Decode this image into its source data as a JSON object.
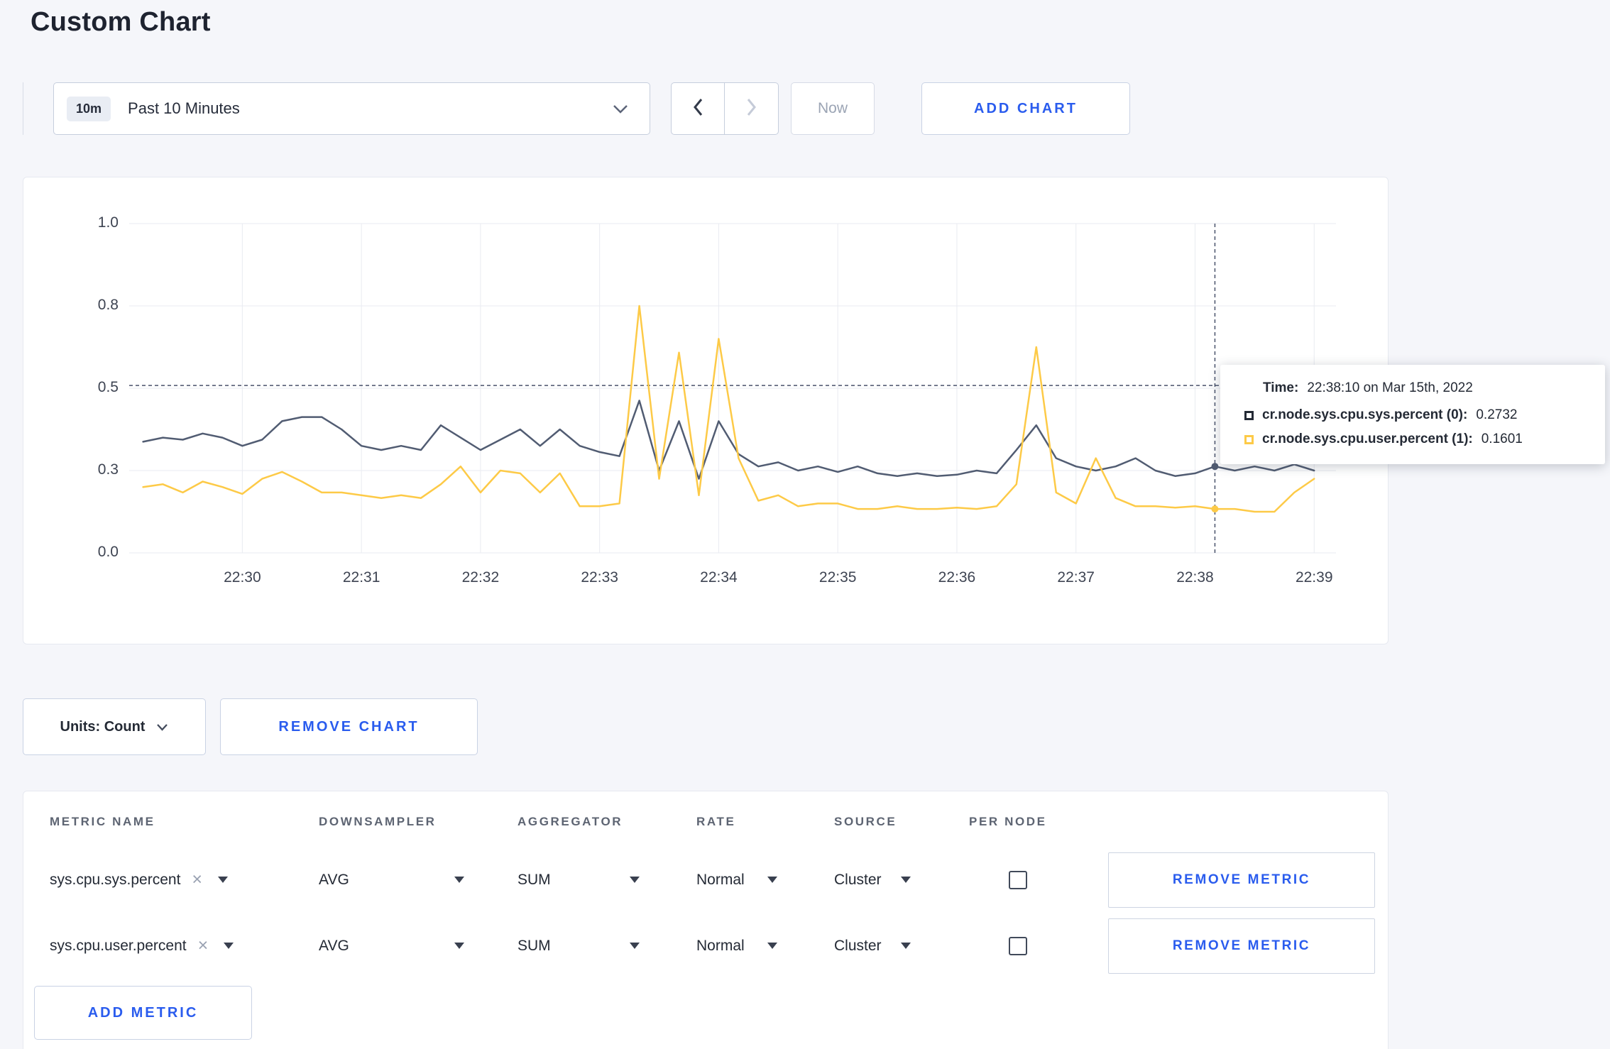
{
  "page": {
    "title": "Custom Chart"
  },
  "colors": {
    "accent": "#2a5cee",
    "gridline": "#e9ebf1",
    "crosshair": "#49526b",
    "series_sys": "#515c72",
    "series_user": "#fdca47",
    "page_background": "#f5f6fa",
    "card_background": "#ffffff"
  },
  "icons": {
    "clear": "×"
  },
  "toolbar": {
    "time_badge": "10m",
    "time_label": "Past 10 Minutes",
    "now_label": "Now",
    "add_chart_label": "ADD CHART"
  },
  "chart_controls": {
    "units_label": "Units: Count",
    "remove_chart_label": "REMOVE CHART"
  },
  "tooltip": {
    "time_label": "Time:",
    "time_value": "22:38:10 on Mar 15th, 2022",
    "series": [
      {
        "name": "cr.node.sys.cpu.sys.percent (0):",
        "value": "0.2732",
        "color": "#242a35"
      },
      {
        "name": "cr.node.sys.cpu.user.percent (1):",
        "value": "0.1601",
        "color": "#fdca47"
      }
    ]
  },
  "chart_data": {
    "type": "line",
    "title": "",
    "xlabel": "",
    "ylabel": "",
    "x_ticks": [
      "22:30",
      "22:31",
      "22:32",
      "22:33",
      "22:34",
      "22:35",
      "22:36",
      "22:37",
      "22:38",
      "22:39"
    ],
    "tick_interval_seconds": 60,
    "y_ticks": [
      "1.0",
      "0.8",
      "0.5",
      "0.3",
      "0.0"
    ],
    "y_scale_stops": [
      0,
      0.3,
      0.5,
      0.8,
      1.0
    ],
    "x_domain_seconds": [
      -57,
      551
    ],
    "x_start_time": "22:29:10",
    "x_start_seconds": -50,
    "x_step_seconds": 10,
    "crosshair": {
      "x_seconds": 490,
      "time": "22:38:10",
      "hline_value": 0.51
    },
    "series": [
      {
        "name": "cr.node.sys.cpu.sys.percent",
        "color": "#515c72",
        "values": [
          0.37,
          0.38,
          0.375,
          0.39,
          0.38,
          0.36,
          0.375,
          0.42,
          0.43,
          0.43,
          0.4,
          0.36,
          0.35,
          0.36,
          0.35,
          0.41,
          0.38,
          0.35,
          0.375,
          0.4,
          0.36,
          0.4,
          0.36,
          0.345,
          0.335,
          0.47,
          0.3,
          0.42,
          0.27,
          0.42,
          0.34,
          0.31,
          0.32,
          0.3,
          0.31,
          0.295,
          0.31,
          0.29,
          0.28,
          0.29,
          0.28,
          0.285,
          0.3,
          0.29,
          0.35,
          0.41,
          0.33,
          0.31,
          0.3,
          0.31,
          0.33,
          0.3,
          0.28,
          0.29,
          0.31,
          0.3,
          0.31,
          0.3,
          0.315,
          0.3
        ]
      },
      {
        "name": "cr.node.sys.cpu.user.percent",
        "color": "#fdca47",
        "values": [
          0.24,
          0.25,
          0.22,
          0.26,
          0.24,
          0.215,
          0.27,
          0.295,
          0.26,
          0.22,
          0.22,
          0.21,
          0.2,
          0.21,
          0.2,
          0.25,
          0.31,
          0.22,
          0.3,
          0.29,
          0.22,
          0.29,
          0.17,
          0.17,
          0.18,
          0.8,
          0.27,
          0.63,
          0.21,
          0.68,
          0.33,
          0.19,
          0.21,
          0.17,
          0.18,
          0.18,
          0.16,
          0.16,
          0.17,
          0.16,
          0.16,
          0.165,
          0.16,
          0.17,
          0.25,
          0.65,
          0.22,
          0.18,
          0.33,
          0.2,
          0.17,
          0.17,
          0.165,
          0.17,
          0.16,
          0.16,
          0.15,
          0.15,
          0.22,
          0.27
        ]
      }
    ]
  },
  "metrics_table": {
    "headers": [
      "METRIC NAME",
      "DOWNSAMPLER",
      "AGGREGATOR",
      "RATE",
      "SOURCE",
      "PER NODE"
    ],
    "rows": [
      {
        "metric": "sys.cpu.sys.percent",
        "downsampler": "AVG",
        "aggregator": "SUM",
        "rate": "Normal",
        "source": "Cluster",
        "per_node": false,
        "remove_label": "REMOVE METRIC"
      },
      {
        "metric": "sys.cpu.user.percent",
        "downsampler": "AVG",
        "aggregator": "SUM",
        "rate": "Normal",
        "source": "Cluster",
        "per_node": false,
        "remove_label": "REMOVE METRIC"
      }
    ],
    "add_metric_label": "ADD METRIC"
  }
}
